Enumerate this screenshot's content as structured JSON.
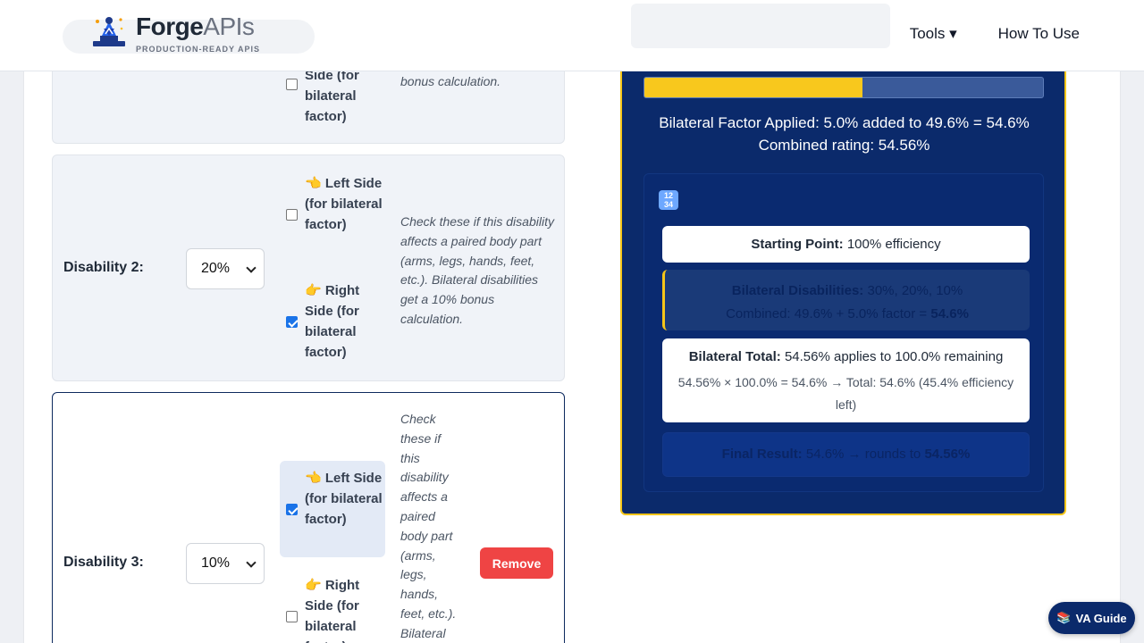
{
  "header": {
    "brand_strong": "Forge",
    "brand_light": "APIs",
    "tagline": "PRODUCTION-READY APIS",
    "nav": {
      "tools": "Tools ▾",
      "how_to_use": "How To Use"
    }
  },
  "disabilities": [
    {
      "right_label_partial": "Side (for bilateral factor)",
      "hint_partial": "bonus calculation.",
      "right_checked": false
    },
    {
      "label": "Disability 2:",
      "rating": "20%",
      "left_label": "👈 Left Side (for bilateral factor)",
      "right_label": "👉 Right Side (for bilateral factor)",
      "left_checked": false,
      "right_checked": true,
      "hint": "Check these if this disability affects a paired body part (arms, legs, hands, feet, etc.). Bilateral disabilities get a 10% bonus calculation."
    },
    {
      "label": "Disability 3:",
      "rating": "10%",
      "left_label": "👈 Left Side (for bilateral factor)",
      "right_label": "👉 Right Side (for bilateral factor)",
      "left_checked": true,
      "right_checked": false,
      "hint": "Check these if this disability affects a paired body part (arms, legs, hands, feet, etc.). Bilateral",
      "remove_label": "Remove"
    }
  ],
  "result": {
    "progress_fraction": 0.546,
    "bilateral_line": "Bilateral Factor Applied: 5.0% added to 49.6% = 54.6%",
    "combined_line": "Combined rating: 54.56%",
    "breakdown_icon": "🔢",
    "steps": {
      "start_label": "Starting Point:",
      "start_value": "100% efficiency",
      "bilateral_label": "Bilateral Disabilities:",
      "bilateral_value": "30%, 20%, 10%",
      "bilateral_combined": "Combined: 49.6% + 5.0% factor =",
      "bilateral_combined_value": "54.6%",
      "total_label": "Bilateral Total:",
      "total_value": "54.56% applies to 100.0% remaining",
      "total_calc": "54.56% × 100.0% = 54.6% → Total: 54.6% (45.4% efficiency left)",
      "final_label": "Final Result:",
      "final_value": "54.6% → rounds to",
      "final_rounded": "54.56%"
    }
  },
  "va_guide": {
    "icon": "📚",
    "label": "VA Guide"
  },
  "colors": {
    "navy": "#0b2a6b",
    "accent": "#f5c518",
    "danger": "#ef4444",
    "checkbox": "#1a73e8"
  }
}
